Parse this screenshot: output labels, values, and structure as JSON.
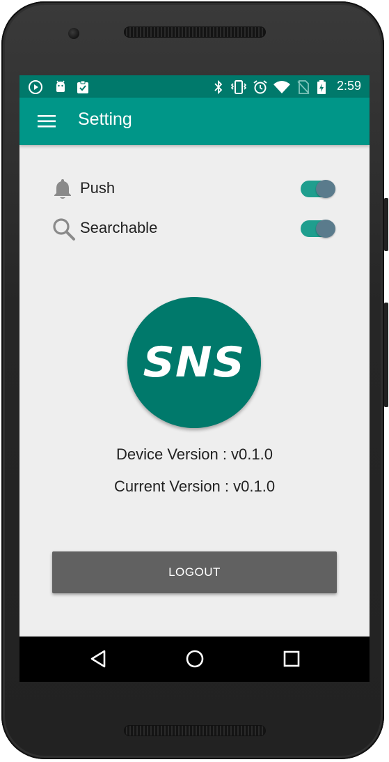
{
  "status_bar": {
    "time": "2:59",
    "left_icons": [
      "play-icon",
      "android-icon",
      "clipboard-check-icon"
    ],
    "right_icons": [
      "bluetooth-icon",
      "vibrate-icon",
      "alarm-icon",
      "wifi-icon",
      "no-sim-icon",
      "battery-charging-icon"
    ]
  },
  "app_bar": {
    "title": "Setting",
    "menu_icon": "hamburger-menu-icon",
    "color": "#009688"
  },
  "settings": [
    {
      "icon": "bell-icon",
      "label": "Push",
      "enabled": true
    },
    {
      "icon": "search-icon",
      "label": "Searchable",
      "enabled": true
    }
  ],
  "logo": {
    "text": "SNS",
    "color": "#00796b"
  },
  "versions": {
    "device": "Device Version : v0.1.0",
    "current": "Current Version : v0.1.0"
  },
  "logout_button": {
    "label": "LOGOUT"
  },
  "nav_bar": [
    "back-icon",
    "home-icon",
    "recents-icon"
  ]
}
